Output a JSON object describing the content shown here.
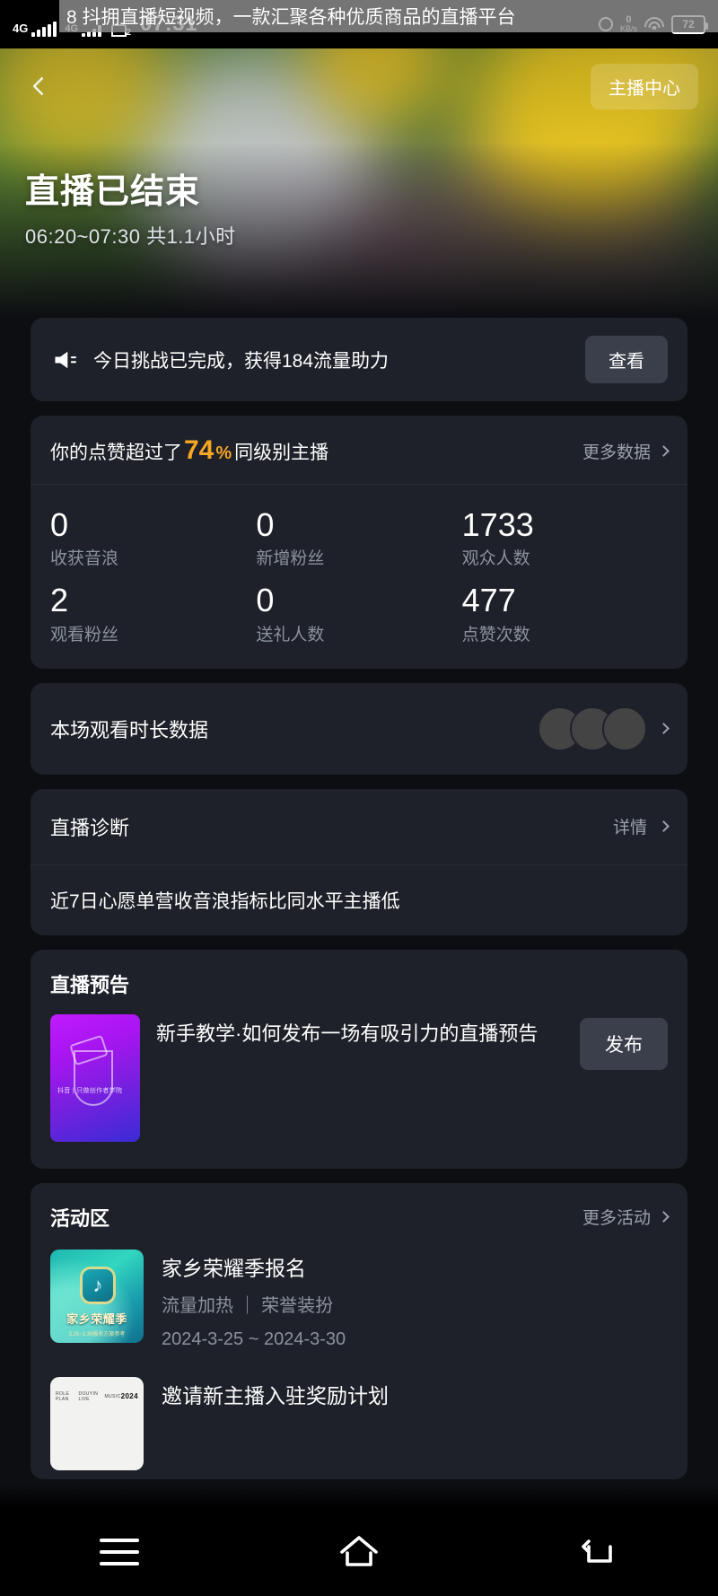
{
  "status_bar": {
    "network_label": "4G",
    "network_label_2": "4G",
    "sim_badge": "2",
    "time": "07:31",
    "net_speed_value": "0",
    "net_speed_unit": "KB/s",
    "battery_percent": "72",
    "overlay_banner": "8 抖拥直播短视频，一款汇聚各种优质商品的直播平台"
  },
  "hero": {
    "back_icon": "chevron-left-icon",
    "anchor_center_label": "主播中心",
    "title": "直播已结束",
    "subtitle": "06:20~07:30 共1.1小时"
  },
  "challenge": {
    "icon": "megaphone-icon",
    "text": "今日挑战已完成，获得184流量助力",
    "button_label": "查看"
  },
  "stats": {
    "rank_prefix": "你的点赞超过了",
    "rank_percent": "74",
    "rank_percent_symbol": "%",
    "rank_suffix": "同级别主播",
    "more_label": "更多数据",
    "items": [
      {
        "value": "0",
        "label": "收获音浪"
      },
      {
        "value": "0",
        "label": "新增粉丝"
      },
      {
        "value": "1733",
        "label": "观众人数"
      },
      {
        "value": "2",
        "label": "观看粉丝"
      },
      {
        "value": "0",
        "label": "送礼人数"
      },
      {
        "value": "477",
        "label": "点赞次数"
      }
    ]
  },
  "watch_duration": {
    "title": "本场观看时长数据",
    "avatar_count": 3
  },
  "diagnosis": {
    "title": "直播诊断",
    "detail_label": "详情",
    "message": "近7日心愿单营收音浪指标比同水平主播低"
  },
  "preview": {
    "section_title": "直播预告",
    "item_title": "新手教学·如何发布一场有吸引力的直播预告",
    "thumb_caption": "抖音 | 只做创作者学院",
    "button_label": "发布"
  },
  "activity": {
    "section_title": "活动区",
    "more_label": "更多活动",
    "items": [
      {
        "title": "家乡荣耀季报名",
        "tags": "流量加热 ｜ 荣誉装扮",
        "date": "2024-3-25 ~ 2024-3-30",
        "thumb_caption": "家乡荣耀季",
        "thumb_subcaption": "3.25~3.30报名方案参考"
      },
      {
        "title": "邀请新主播入驻奖励计划",
        "thumb_label_1": "ROLE PLAN",
        "thumb_label_2": "DOUYIN LIVE",
        "thumb_label_3": "MUSIC",
        "thumb_label_4": "2024"
      }
    ]
  },
  "nav_bar": {
    "recent_icon": "menu-icon",
    "home_icon": "home-icon",
    "back_icon": "back-arrow-icon"
  },
  "colors": {
    "accent_orange": "#f5a623",
    "card_bg": "#1e2129",
    "page_bg": "#0d0e12",
    "button_bg": "#3a3f4b",
    "muted_text": "#8b929e"
  }
}
